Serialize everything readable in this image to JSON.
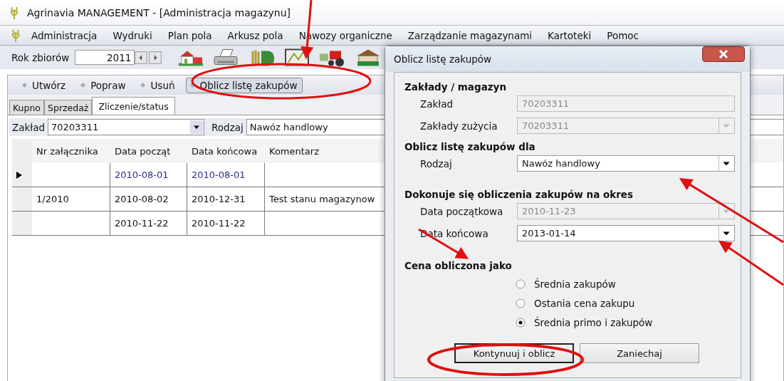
{
  "window": {
    "title": "Agrinavia MANAGEMENT - [Administracja magazynu]"
  },
  "menu": [
    {
      "label": "Administracja"
    },
    {
      "label": "Wydruki"
    },
    {
      "label": "Plan pola"
    },
    {
      "label": "Arkusz pola"
    },
    {
      "label": "Nawozy organiczne"
    },
    {
      "label": "Zarządzanie magazynami"
    },
    {
      "label": "Kartoteki"
    },
    {
      "label": "Pomoc"
    }
  ],
  "toolbar": {
    "year_label": "Rok zbiorów",
    "year_value": "2011"
  },
  "actions": [
    {
      "label": "Utwórz",
      "highlighted": false
    },
    {
      "label": "Popraw",
      "highlighted": false
    },
    {
      "label": "Usuń",
      "highlighted": false
    },
    {
      "label": "Oblicz listę zakupów",
      "highlighted": true
    }
  ],
  "tabs": [
    {
      "label": "Kupno",
      "selected": false
    },
    {
      "label": "Sprzedaż",
      "selected": false
    },
    {
      "label": "Zliczenie/status",
      "selected": true
    }
  ],
  "filter": {
    "zaklad_label": "Zakład",
    "zaklad_value": "70203311",
    "rodzaj_label": "Rodzaj",
    "rodzaj_value": "Nawóz handlowy"
  },
  "table": {
    "columns": [
      "Nr załącznika",
      "Data począt",
      "Data końcowa",
      "Komentarz"
    ],
    "rows": [
      {
        "selected": true,
        "cells": [
          "",
          "2010-08-01",
          "2010-08-01",
          ""
        ]
      },
      {
        "selected": false,
        "cells": [
          "1/2010",
          "2010-08-02",
          "2010-12-31",
          "Test stanu magazynow"
        ]
      },
      {
        "selected": false,
        "cells": [
          "",
          "2010-11-22",
          "2010-11-22",
          ""
        ]
      }
    ]
  },
  "dialog": {
    "title": "Oblicz listę zakupów",
    "sections": [
      {
        "heading": "Zakłady / magazyn",
        "fields": [
          {
            "label": "Zakład",
            "value": "70203311",
            "kind": "text",
            "disabled": true
          },
          {
            "label": "Zakłady zużycia",
            "value": "70203311",
            "kind": "combo",
            "disabled": true
          }
        ]
      },
      {
        "heading": "Oblicz listę zakupów dla",
        "fields": [
          {
            "label": "Rodzaj",
            "value": "Nawóz handlowy",
            "kind": "combo",
            "disabled": false
          }
        ]
      },
      {
        "heading": "Dokonuje się obliczenia zakupów na okres",
        "fields": [
          {
            "label": "Data początkowa",
            "value": "2010-11-23",
            "kind": "combo",
            "disabled": true
          },
          {
            "label": "Data końcowa",
            "value": "2013-01-14",
            "kind": "combo",
            "disabled": false
          }
        ]
      },
      {
        "heading": "Cena obliczona jako"
      }
    ],
    "options": [
      {
        "label": "Średnia zakupów",
        "selected": false
      },
      {
        "label": "Ostania cena zakupu",
        "selected": false
      },
      {
        "label": "Średnia primo i zakupów",
        "selected": true
      }
    ],
    "buttons": [
      {
        "label": "Kontynuuj i oblicz",
        "default": true
      },
      {
        "label": "Zaniechaj",
        "default": false
      }
    ]
  }
}
